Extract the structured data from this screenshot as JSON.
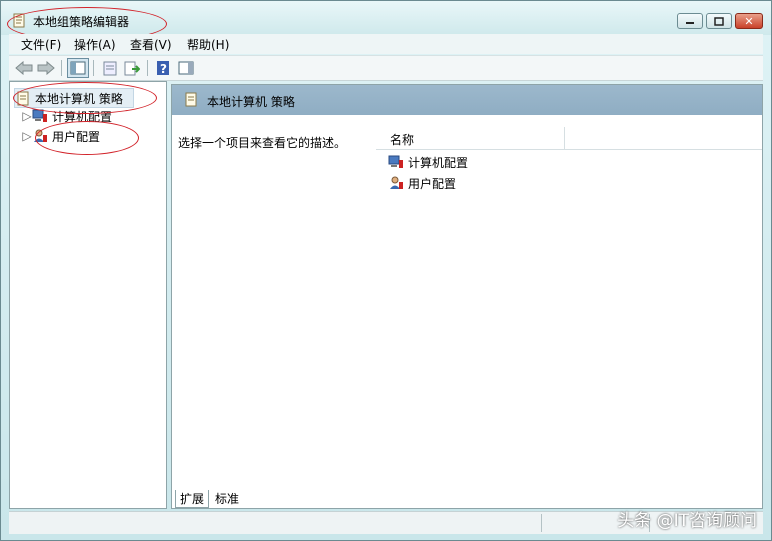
{
  "window": {
    "title": "本地组策略编辑器",
    "icon": "policy-document-icon"
  },
  "menu": [
    {
      "label": "文件(F)"
    },
    {
      "label": "操作(A)"
    },
    {
      "label": "查看(V)"
    },
    {
      "label": "帮助(H)"
    }
  ],
  "toolbar": {
    "buttons": [
      "back-arrow-icon",
      "forward-arrow-icon",
      "show-tree-icon",
      "properties-icon",
      "export-icon",
      "help-icon",
      "show-hide-action-pane-icon"
    ]
  },
  "tree": {
    "root": "本地计算机 策略",
    "items": [
      {
        "label": "计算机配置",
        "icon": "computer-config-icon"
      },
      {
        "label": "用户配置",
        "icon": "user-config-icon"
      }
    ]
  },
  "details": {
    "header_title": "本地计算机 策略",
    "description": "选择一个项目来查看它的描述。",
    "column_name": "名称",
    "rows": [
      {
        "label": "计算机配置",
        "icon": "computer-config-icon"
      },
      {
        "label": "用户配置",
        "icon": "user-config-icon"
      }
    ]
  },
  "tabs": [
    {
      "label": "扩展",
      "active": true
    },
    {
      "label": "标准",
      "active": false
    }
  ],
  "watermark": "头条 @IT咨询顾问",
  "colors": {
    "highlight_oval": "#d2232a",
    "header_bar": "#94b2c7"
  }
}
